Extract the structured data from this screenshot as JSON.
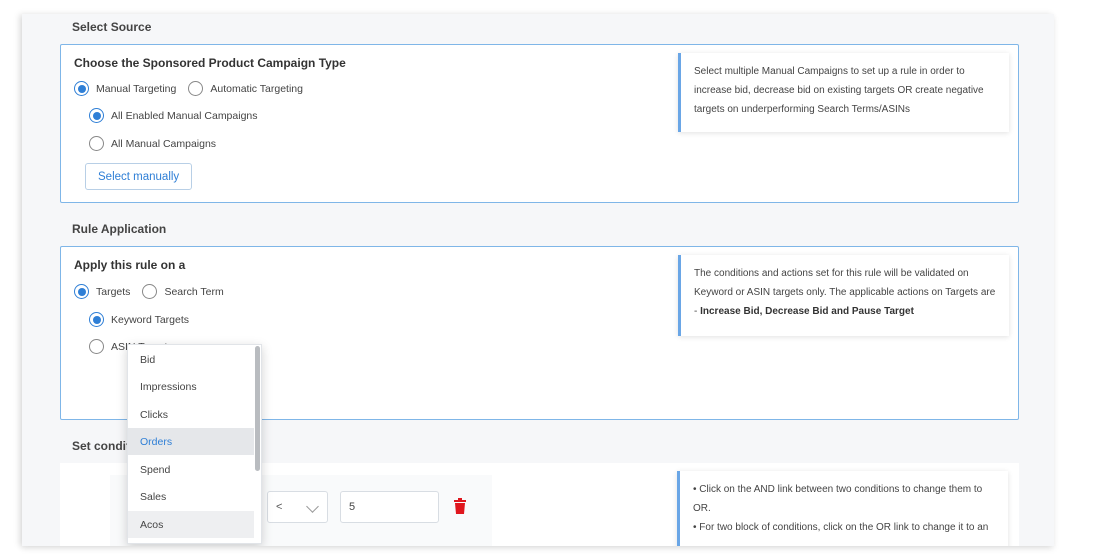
{
  "select_source": {
    "title": "Select Source",
    "card_title": "Choose the Sponsored Product Campaign Type",
    "targeting_options": [
      "Manual Targeting",
      "Automatic Targeting"
    ],
    "campaign_options": [
      "All Enabled Manual Campaigns",
      "All Manual Campaigns"
    ],
    "select_manually_label": "Select manually",
    "info_text": "Select multiple Manual Campaigns to set up a rule in order to increase bid, decrease bid on existing targets OR create negative targets on underperforming Search Terms/ASINs"
  },
  "rule_application": {
    "title": "Rule Application",
    "card_title": "Apply this rule on a",
    "apply_options": [
      "Targets",
      "Search Term"
    ],
    "target_options": [
      "Keyword Targets",
      "ASIN Targets"
    ],
    "info_text": "The conditions and actions set for this rule will be validated on Keyword or ASIN targets only. The applicable actions on Targets are - ",
    "info_bold": "Increase Bid, Decrease Bid and Pause Target"
  },
  "conditions": {
    "title": "Set conditions",
    "operator_value": "<",
    "value": "5",
    "info_line1": "• Click on the AND link between two conditions to change them to OR.",
    "info_line2": "• For two block of conditions, click on the OR link to change it to an"
  },
  "metric_dropdown": {
    "items": [
      "Bid",
      "Impressions",
      "Clicks",
      "Orders",
      "Spend",
      "Sales",
      "Acos"
    ],
    "highlighted": "Orders"
  },
  "colors": {
    "accent": "#2f7fd6",
    "card_border": "#7fb6e8",
    "delete": "#e0161d"
  }
}
